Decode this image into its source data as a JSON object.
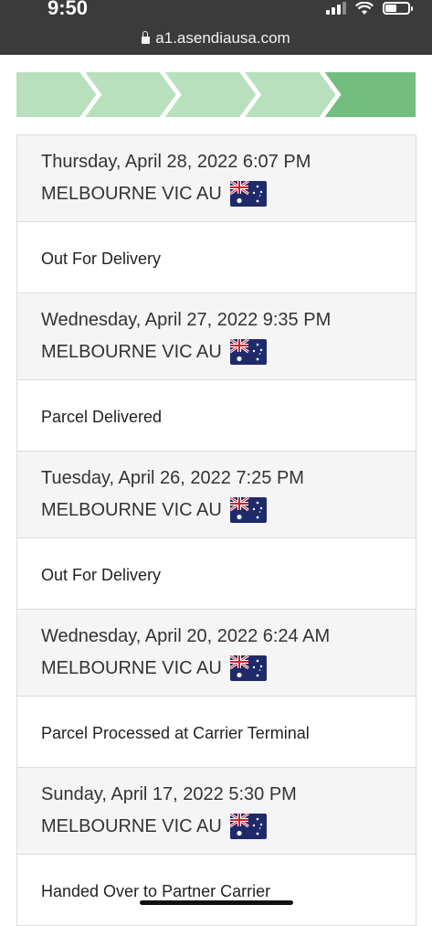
{
  "status_bar": {
    "time": "9:50",
    "url": "a1.asendiausa.com"
  },
  "progress": {
    "total_steps": 5,
    "completed_steps": 5,
    "current_step": 5,
    "colors": {
      "done": "#b8e0bd",
      "current": "#73bd7f"
    }
  },
  "events": [
    {
      "date": "Thursday, April 28, 2022 6:07 PM",
      "location": "MELBOURNE VIC AU",
      "status": "Out For Delivery"
    },
    {
      "date": "Wednesday, April 27, 2022 9:35 PM",
      "location": "MELBOURNE VIC AU",
      "status": "Parcel Delivered"
    },
    {
      "date": "Tuesday, April 26, 2022 7:25 PM",
      "location": "MELBOURNE VIC AU",
      "status": "Out For Delivery"
    },
    {
      "date": "Wednesday, April 20, 2022 6:24 AM",
      "location": "MELBOURNE VIC AU",
      "status": "Parcel Processed at Carrier Terminal"
    },
    {
      "date": "Sunday, April 17, 2022 5:30 PM",
      "location": "MELBOURNE VIC AU",
      "status": "Handed Over to Partner Carrier"
    }
  ],
  "icons": {
    "flag": "australia-flag-icon",
    "lock": "lock-icon"
  }
}
